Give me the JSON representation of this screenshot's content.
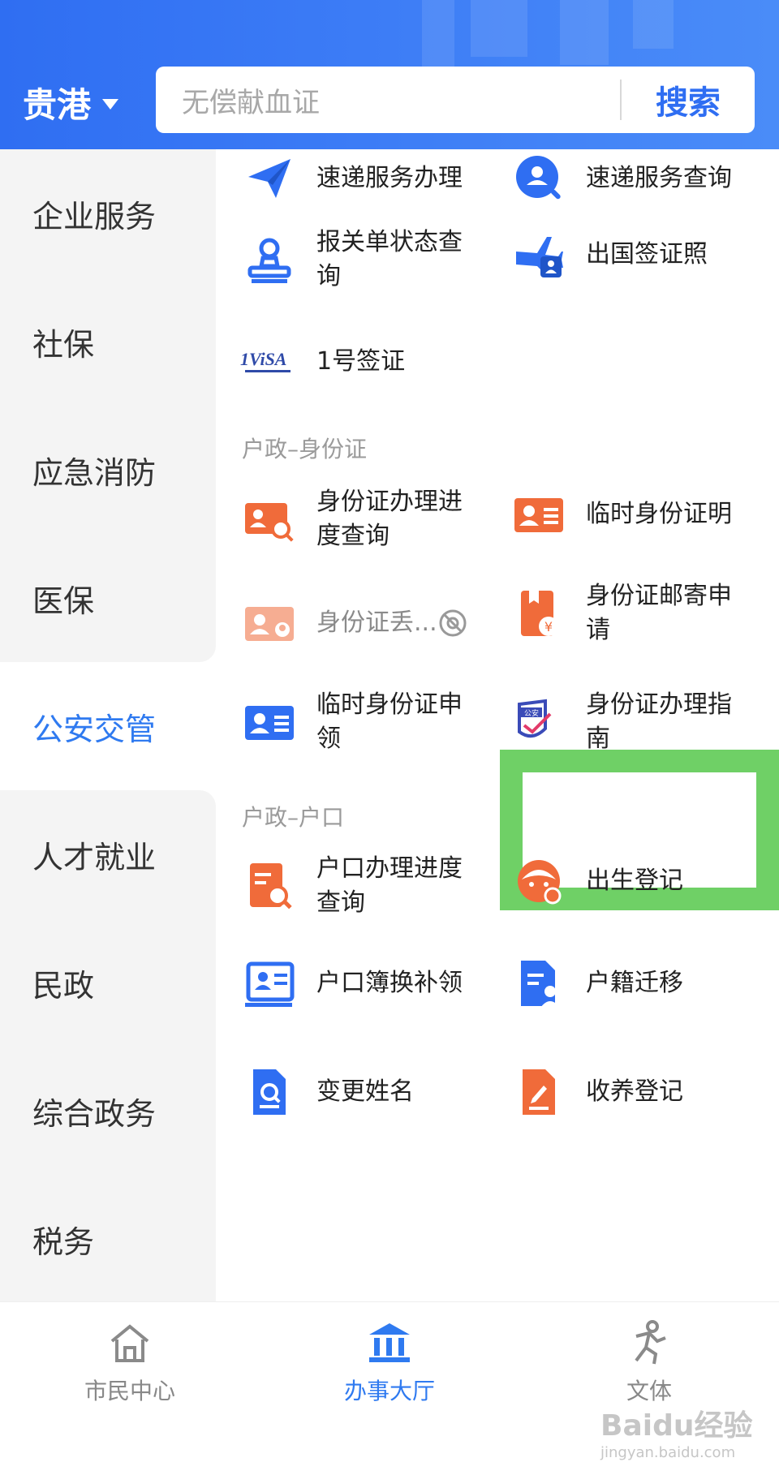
{
  "header": {
    "city": "贵港",
    "search_placeholder": "无偿献血证",
    "search_button": "搜索"
  },
  "sidebar": {
    "items": [
      {
        "label": "企业服务"
      },
      {
        "label": "社保"
      },
      {
        "label": "应急消防"
      },
      {
        "label": "医保"
      },
      {
        "label": "公安交管"
      },
      {
        "label": "人才就业"
      },
      {
        "label": "民政"
      },
      {
        "label": "综合政务"
      },
      {
        "label": "税务"
      }
    ],
    "active": "公安交管"
  },
  "content": {
    "sec_exit": {
      "items": [
        {
          "label": "速递服务办理",
          "icon": "paper-plane-icon"
        },
        {
          "label": "速递服务查询",
          "icon": "user-search-icon"
        },
        {
          "label": "报关单状态查询",
          "icon": "stamp-icon"
        },
        {
          "label": "出国签证照",
          "icon": "plane-person-icon"
        },
        {
          "label": "1号签证",
          "icon": "1visa-logo-icon",
          "logo_text": "1ViSA"
        }
      ]
    },
    "sec_id": {
      "title": "户政–身份证",
      "items": [
        {
          "label": "身份证办理进度查询",
          "icon": "id-card-search-icon"
        },
        {
          "label": "临时身份证明",
          "icon": "id-card-icon"
        },
        {
          "label": "身份证丢...",
          "icon": "id-card-person-icon"
        },
        {
          "label": "身份证邮寄申请",
          "icon": "mail-yuan-icon"
        },
        {
          "label": "临时身份证申领",
          "icon": "id-card-blue-icon"
        },
        {
          "label": "身份证办理指南",
          "icon": "police-shield-icon",
          "badge": "公安"
        }
      ]
    },
    "sec_hukou": {
      "title": "户政–户口",
      "items": [
        {
          "label": "户口办理进度查询",
          "icon": "doc-search-icon"
        },
        {
          "label": "出生登记",
          "icon": "baby-face-icon"
        },
        {
          "label": "户口簿换补领",
          "icon": "booklet-icon"
        },
        {
          "label": "户籍迁移",
          "icon": "doc-person-icon"
        },
        {
          "label": "变更姓名",
          "icon": "doc-magnifier-icon"
        },
        {
          "label": "收养登记",
          "icon": "doc-pen-icon"
        }
      ]
    }
  },
  "tabbar": {
    "items": [
      {
        "label": "市民中心",
        "icon": "home-icon"
      },
      {
        "label": "办事大厅",
        "icon": "hall-icon"
      },
      {
        "label": "文体",
        "icon": "runner-icon"
      }
    ]
  },
  "watermark": {
    "text": "Baidu经验",
    "sub": "jingyan.baidu.com"
  },
  "colors": {
    "primary": "#2f6ef2",
    "active_text": "#2f7af0",
    "orange": "#f06b3a",
    "highlight": "#6fd066"
  }
}
